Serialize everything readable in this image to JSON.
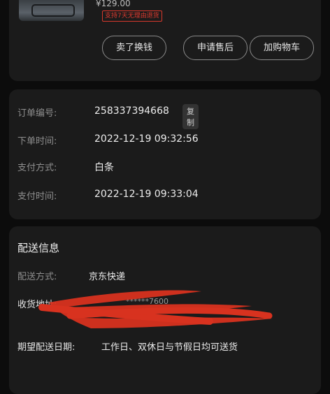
{
  "product": {
    "price_fragment": "¥129.00",
    "promo_badge": "支持7天无理由退货",
    "buttons": [
      "卖了换钱",
      "申请售后",
      "加购物车"
    ]
  },
  "order_info": {
    "rows": [
      {
        "label": "订单编号:",
        "value": "258337394668",
        "copy": "复制"
      },
      {
        "label": "下单时间:",
        "value": "2022-12-19 09:32:56"
      },
      {
        "label": "支付方式:",
        "value": "白条"
      },
      {
        "label": "支付时间:",
        "value": "2022-12-19 09:33:04"
      }
    ]
  },
  "shipping": {
    "title": "配送信息",
    "method_label": "配送方式:",
    "method_value": "京东快递",
    "address_label": "收货地址:",
    "address_value_partial": "******7600",
    "date_label": "期望配送日期:",
    "date_value": "工作日、双休日与节假日均可送货"
  }
}
